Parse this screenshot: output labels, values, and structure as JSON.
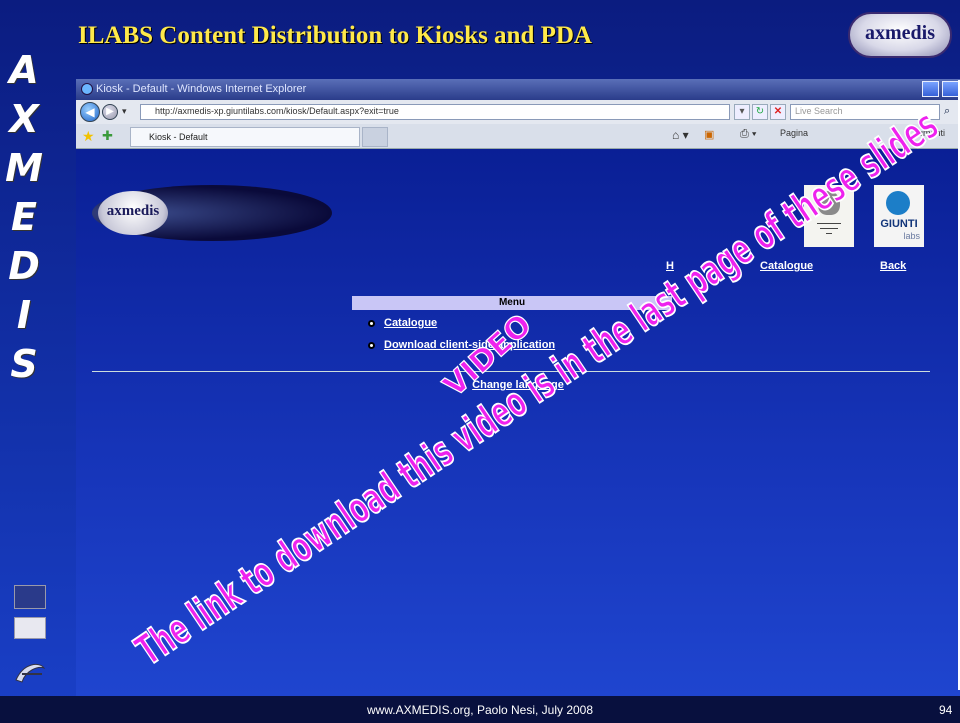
{
  "slide": {
    "title": "ILABS Content Distribution to Kiosks and PDA",
    "logo_text": "axmedis",
    "side_letters": [
      "A",
      "X",
      "M",
      "E",
      "D",
      "I",
      "S"
    ],
    "footer": "www.AXMEDIS.org, Paolo Nesi, July 2008",
    "page_number": "94"
  },
  "browser": {
    "window_title": "Kiosk - Default - Windows Internet Explorer",
    "address_url": "http://axmedis-xp.giuntilabs.com/kiosk/Default.aspx?exit=true",
    "search_placeholder": "Live Search",
    "tab_title": "Kiosk - Default",
    "toolbar_page": "Pagina",
    "toolbar_tools": "umenti"
  },
  "page": {
    "logo_text": "axmedis",
    "partner2_text": "GIUNTI",
    "partner2_sub": "labs",
    "nav_home": "H",
    "nav_catalogue": "Catalogue",
    "nav_back": "Back",
    "menu_title": "Menu",
    "menu_items": [
      "Catalogue",
      "Download client-side application"
    ],
    "change_language": "Change language"
  },
  "overlay": {
    "video_label": "VIDEO",
    "download_note": "The link to download this video is in the last page of these slides"
  },
  "colors": {
    "title_yellow": "#ffe94a",
    "watermark_magenta": "#ee22ee",
    "page_blue": "#1634b8"
  }
}
